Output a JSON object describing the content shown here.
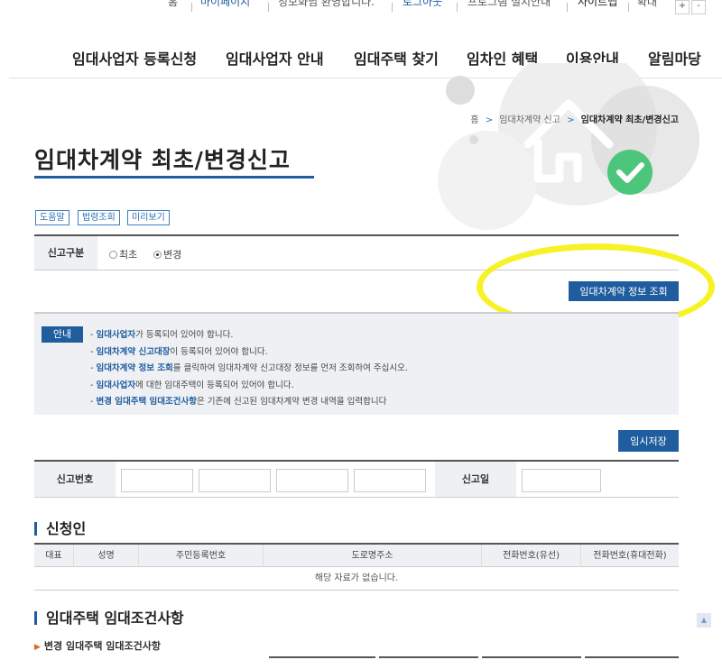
{
  "utility_links": [
    "홈",
    "마이페이지",
    "청보화님 환영합니다.",
    "로그아웃",
    "프로그램 설치안내",
    "사이트맵",
    "확대"
  ],
  "zoom_buttons": [
    "+",
    "-"
  ],
  "gnb": [
    "임대사업자 등록신청",
    "임대사업자 안내",
    "임대주택 찾기",
    "임차인 혜택",
    "이용안내",
    "알림마당"
  ],
  "breadcrumb": {
    "home": "홈",
    "parent": "임대차계약 신고",
    "current": "임대차계약 최초/변경신고",
    "arrow": ">"
  },
  "page_title": "임대차계약 최초/변경신고",
  "tool_buttons": [
    "도움말",
    "법령조회",
    "미리보기"
  ],
  "report_type": {
    "label": "신고구분",
    "options": [
      "최초",
      "변경"
    ],
    "selected": "변경"
  },
  "lookup_button": "임대차계약 정보 조회",
  "notice": {
    "badge": "안내",
    "items": [
      {
        "pre": "- ",
        "hl": "임대사업자",
        "post": "가 등록되어 있어야 합니다."
      },
      {
        "pre": "- ",
        "hl": "임대차계약 신고대장",
        "post": "이 등록되어 있어야 합니다."
      },
      {
        "pre": "- ",
        "hl": "임대차계약 정보 조회",
        "post": "를 클릭하여 임대차계약 신고대장 정보를 먼저 조회하여 주십시오."
      },
      {
        "pre": "- ",
        "hl": "임대사업자",
        "post": "에 대한 임대주택이 등록되어 있어야 합니다."
      },
      {
        "pre": "- ",
        "hl": "변경 임대주택 임대조건사항",
        "post": "은 기존에 신고된 임대차계약 변경 내역을 입력합니다"
      }
    ]
  },
  "temp_save_button": "임시저장",
  "report_no_label": "신고번호",
  "report_date_label": "신고일",
  "applicant": {
    "title": "신청인",
    "columns": [
      "대표",
      "성명",
      "주민등록번호",
      "도로명주소",
      "전화번호(유선)",
      "전화번호(휴대전화)"
    ],
    "empty": "해당 자료가 없습니다."
  },
  "rental_section_title": "임대주택 임대조건사항",
  "rental_sub_title": "변경 임대주택 임대조건사항",
  "top_button": "▲",
  "colors": {
    "primary": "#1f5d9e",
    "highlight": "#f4f000",
    "check": "#4cc67b"
  }
}
